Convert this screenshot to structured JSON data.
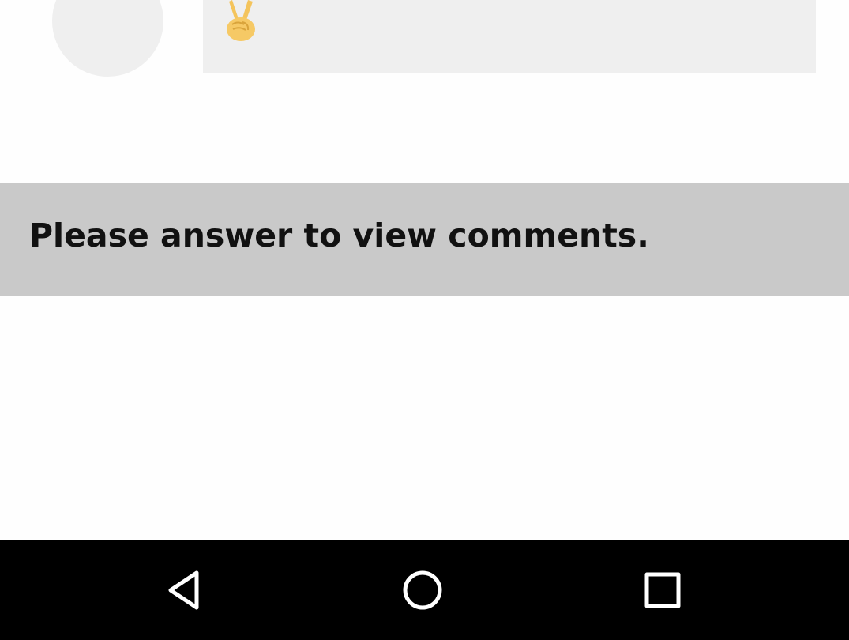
{
  "post": {
    "emoji_icon": "victory-hand-icon"
  },
  "comments_gate": {
    "message": "Please answer to view comments."
  },
  "system_nav": {
    "back_icon": "back-triangle-icon",
    "home_icon": "home-circle-icon",
    "recents_icon": "recents-square-icon"
  },
  "colors": {
    "placeholder_gray": "#efefef",
    "banner_gray": "#c9c9c9",
    "nav_bar": "#000000"
  }
}
